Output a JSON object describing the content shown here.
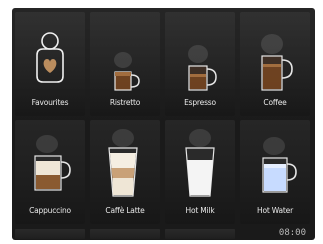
{
  "tiles": [
    {
      "label": "Favourites",
      "icon": "favourites-heart-person-icon"
    },
    {
      "label": "Ristretto",
      "icon": "ristretto-cup-icon"
    },
    {
      "label": "Espresso",
      "icon": "espresso-cup-icon"
    },
    {
      "label": "Coffee",
      "icon": "coffee-cup-icon"
    },
    {
      "label": "Cappuccino",
      "icon": "cappuccino-cup-icon"
    },
    {
      "label": "Caffè Latte",
      "icon": "latte-glass-icon"
    },
    {
      "label": "Hot Milk",
      "icon": "hot-milk-glass-icon"
    },
    {
      "label": "Hot Water",
      "icon": "hot-water-cup-icon"
    }
  ],
  "status": {
    "time": "08:00"
  },
  "colors": {
    "background": "#1a1a1a",
    "tile": "#232323",
    "label": "#e9e9e9",
    "coffee": "#6b3e1c",
    "milk_foam": "#efe6d6",
    "water": "#bcd3ff"
  }
}
